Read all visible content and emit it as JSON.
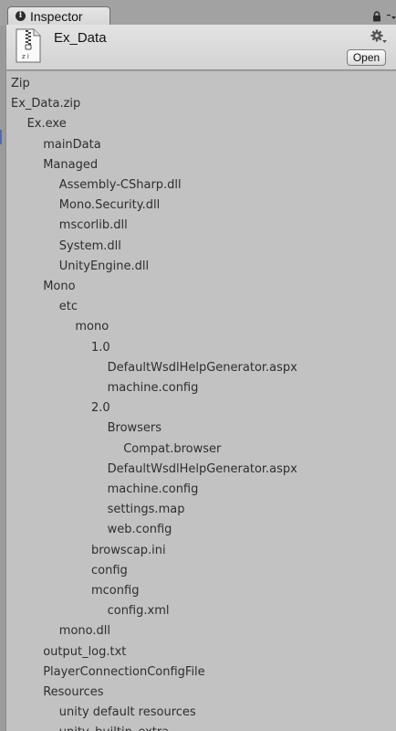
{
  "tab": {
    "icon": "info-icon",
    "label": "Inspector"
  },
  "header": {
    "file_icon": "zip-file-icon",
    "title": "Ex_Data",
    "settings_icon": "gear-icon",
    "open_label": "Open"
  },
  "tree": {
    "lines": [
      {
        "text": "Zip",
        "depth": 0
      },
      {
        "text": "Ex_Data.zip",
        "depth": 0
      },
      {
        "text": "Ex.exe",
        "depth": 1
      },
      {
        "text": "mainData",
        "depth": 2
      },
      {
        "text": "Managed",
        "depth": 2
      },
      {
        "text": "Assembly-CSharp.dll",
        "depth": 3
      },
      {
        "text": "Mono.Security.dll",
        "depth": 3
      },
      {
        "text": "mscorlib.dll",
        "depth": 3
      },
      {
        "text": "System.dll",
        "depth": 3
      },
      {
        "text": "UnityEngine.dll",
        "depth": 3
      },
      {
        "text": "Mono",
        "depth": 2
      },
      {
        "text": "etc",
        "depth": 3
      },
      {
        "text": "mono",
        "depth": 4
      },
      {
        "text": "1.0",
        "depth": 5
      },
      {
        "text": "DefaultWsdlHelpGenerator.aspx",
        "depth": 6
      },
      {
        "text": "machine.config",
        "depth": 6
      },
      {
        "text": "2.0",
        "depth": 5
      },
      {
        "text": "Browsers",
        "depth": 6
      },
      {
        "text": "Compat.browser",
        "depth": 7
      },
      {
        "text": "DefaultWsdlHelpGenerator.aspx",
        "depth": 6
      },
      {
        "text": "machine.config",
        "depth": 6
      },
      {
        "text": "settings.map",
        "depth": 6
      },
      {
        "text": "web.config",
        "depth": 6
      },
      {
        "text": "browscap.ini",
        "depth": 5
      },
      {
        "text": "config",
        "depth": 5
      },
      {
        "text": "mconfig",
        "depth": 5
      },
      {
        "text": "config.xml",
        "depth": 6
      },
      {
        "text": "mono.dll",
        "depth": 3
      },
      {
        "text": "output_log.txt",
        "depth": 2
      },
      {
        "text": "PlayerConnectionConfigFile",
        "depth": 2
      },
      {
        "text": "Resources",
        "depth": 2
      },
      {
        "text": "unity default resources",
        "depth": 3
      },
      {
        "text": "unity_builtin_extra",
        "depth": 3
      }
    ]
  }
}
